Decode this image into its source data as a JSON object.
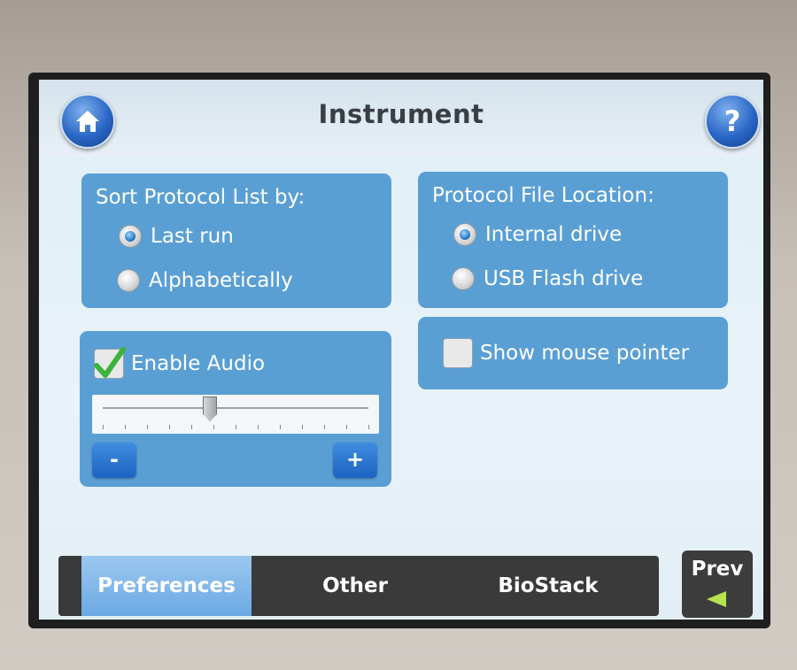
{
  "header": {
    "title": "Instrument",
    "home_icon": "home-icon",
    "help_icon": "help-icon",
    "help_glyph": "?"
  },
  "sort_panel": {
    "title": "Sort Protocol List by:",
    "options": [
      {
        "label": "Last run",
        "selected": true
      },
      {
        "label": "Alphabetically",
        "selected": false
      }
    ]
  },
  "location_panel": {
    "title": "Protocol File Location:",
    "options": [
      {
        "label": "Internal drive",
        "selected": true
      },
      {
        "label": "USB Flash drive",
        "selected": false
      }
    ]
  },
  "audio_panel": {
    "checkbox_label": "Enable Audio",
    "checked": true,
    "volume_fraction": 0.4,
    "minus_label": "-",
    "plus_label": "+"
  },
  "mouse_panel": {
    "checkbox_label": "Show mouse pointer",
    "checked": false
  },
  "tabs": [
    {
      "label": "Preferences",
      "active": true
    },
    {
      "label": "Other",
      "active": false
    },
    {
      "label": "BioStack",
      "active": false
    }
  ],
  "prev_button": {
    "label": "Prev",
    "arrow_color": "#b6e34f"
  },
  "colors": {
    "panel": "#5a9fd4",
    "accent_button": "#1d63c1",
    "tabbar": "#3a3a3a"
  }
}
